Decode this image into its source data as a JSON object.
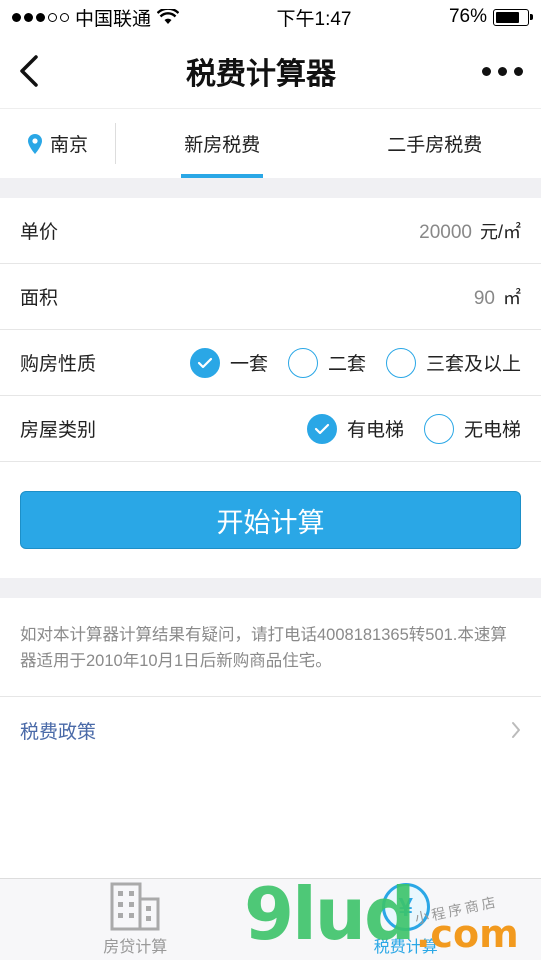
{
  "status": {
    "carrier": "中国联通",
    "time": "下午1:47",
    "battery": "76%"
  },
  "nav": {
    "title": "税费计算器"
  },
  "tabs": {
    "city": "南京",
    "items": [
      "新房税费",
      "二手房税费"
    ]
  },
  "form": {
    "price": {
      "label": "单价",
      "value": "20000",
      "unit": "元/㎡"
    },
    "area": {
      "label": "面积",
      "value": "90",
      "unit": "㎡"
    },
    "purchase_type": {
      "label": "购房性质",
      "options": [
        "一套",
        "二套",
        "三套及以上"
      ],
      "selected": "一套"
    },
    "house_type": {
      "label": "房屋类别",
      "options": [
        "有电梯",
        "无电梯"
      ],
      "selected": "有电梯"
    }
  },
  "button": {
    "calculate": "开始计算"
  },
  "notice": "如对本计算器计算结果有疑问，请打电话4008181365转501.本速算器适用于2010年10月1日后新购商品住宅。",
  "policy": {
    "label": "税费政策"
  },
  "bottom_nav": {
    "items": [
      "房贷计算",
      "税费计算"
    ],
    "active": "税费计算"
  },
  "watermark": {
    "main": "9lud",
    "suffix": ".com",
    "tag": "小程序商店"
  },
  "colors": {
    "accent": "#2aa7e6"
  }
}
